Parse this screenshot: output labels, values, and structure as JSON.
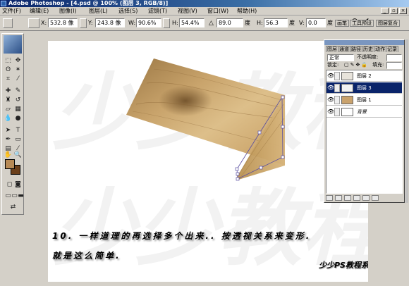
{
  "window": {
    "title": "Adobe Photoshop - [4.psd @ 100% (图层 3, RGB/8)]"
  },
  "menu": [
    "文件(F)",
    "编辑(E)",
    "图像(I)",
    "图层(L)",
    "选择(S)",
    "滤镜(T)",
    "视图(V)",
    "窗口(W)",
    "帮助(H)"
  ],
  "options": {
    "x_label": "X:",
    "x_value": "532.8 像",
    "y_label": "Y:",
    "y_value": "243.8 像",
    "w_label": "W:",
    "w_value": "90.6%",
    "h_label": "H:",
    "h_value": "54.4%",
    "angle_value": "89.0",
    "angle_unit": "度",
    "hskew_label": "H:",
    "hskew_value": "56.3",
    "hskew_unit": "度",
    "vskew_label": "V:",
    "vskew_value": "0.0",
    "vskew_unit": "度",
    "cancel_icon": "cancel-icon",
    "commit_icon": "commit-checkmark-icon"
  },
  "palette_well": [
    "画笔",
    "工具预设",
    "图层复合"
  ],
  "toolbox": {
    "tools": [
      "marquee",
      "move",
      "lasso",
      "magic-wand",
      "crop",
      "slice",
      "healing",
      "brush",
      "stamp",
      "history-brush",
      "eraser",
      "gradient",
      "blur",
      "dodge",
      "path-select",
      "type",
      "pen",
      "shape",
      "notes",
      "eyedropper",
      "hand",
      "zoom"
    ],
    "foreground_color": "#b88a55",
    "background_color": "#6b3f1a"
  },
  "canvas": {
    "watermark": "少少教程",
    "caption_line1": "10. 一样道理的再选择多个出来.. 按透视关系来变形.",
    "caption_line2": "就是这么简单.",
    "brand": "少少PS教程系列"
  },
  "layers_panel": {
    "tabs": [
      "图层",
      "通道",
      "路径",
      "历史",
      "动作",
      "记录"
    ],
    "blend_mode": "正常",
    "opacity_label": "不透明度:",
    "lock_label": "锁定:",
    "fill_label": "填充:",
    "layers": [
      {
        "name": "图层 2",
        "selected": false,
        "thumb": "#e8e4dc"
      },
      {
        "name": "图层 3",
        "selected": true,
        "thumb": "#f2f2f2"
      },
      {
        "name": "图层 1",
        "selected": false,
        "thumb": "#c9a26c"
      },
      {
        "name": "背景",
        "selected": false,
        "thumb": "#ffffff"
      }
    ]
  }
}
